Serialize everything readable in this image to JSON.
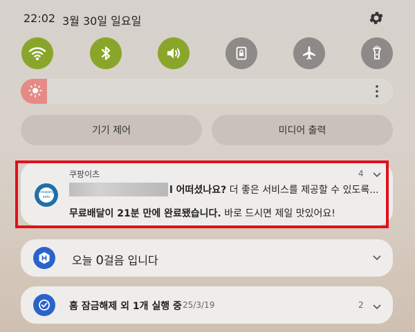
{
  "status_bar": {
    "time": "22:02",
    "date": "3월 30일 일요일"
  },
  "quick_settings": {
    "toggles": [
      {
        "icon": "wifi-icon",
        "state": "on"
      },
      {
        "icon": "bluetooth-icon",
        "state": "on"
      },
      {
        "icon": "sound-icon",
        "state": "on"
      },
      {
        "icon": "screen-lock-rotation-icon",
        "state": "off"
      },
      {
        "icon": "airplane-icon",
        "state": "off"
      },
      {
        "icon": "flashlight-icon",
        "state": "off"
      }
    ],
    "brightness": {
      "level": 0.07
    },
    "device_control_label": "기기 제어",
    "media_output_label": "미디어 출력"
  },
  "notifications": [
    {
      "app": "쿠팡이츠",
      "count": "4",
      "line1_bold": "l 어떠셨나요?",
      "line1_rest": " 더 좋은 서비스를 제공할 수 있도록...",
      "line2_bold": "무료배달이 21분 만에 완료됐습니다.",
      "line2_rest": " 바로 드시면 제일 맛있어요!",
      "icon_text": "coupang eats"
    },
    {
      "text_prefix": "오늘 ",
      "text_number": "0",
      "text_suffix": "걸음 입니다"
    },
    {
      "text": "홈 잠금해제 외 1개 실행 중",
      "date": "25/3/19",
      "count": "2"
    }
  ],
  "colors": {
    "accent_on": "#8aa62a",
    "toggle_off": "#8e8a87",
    "highlight": "#e0101b",
    "brightness": "#e68a86"
  }
}
